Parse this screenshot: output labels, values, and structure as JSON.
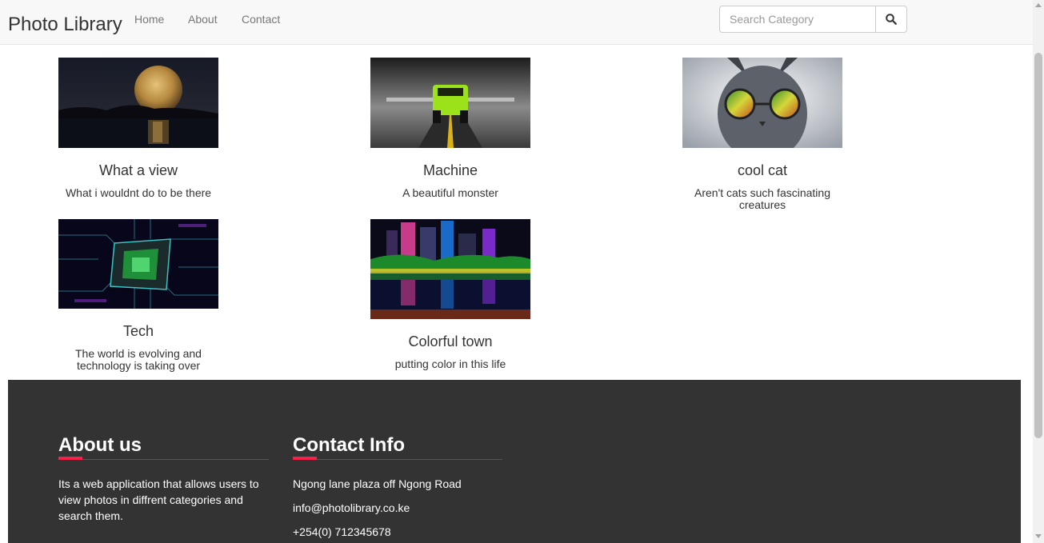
{
  "navbar": {
    "brand": "Photo Library",
    "links": [
      "Home",
      "About",
      "Contact"
    ],
    "search_placeholder": "Search Category"
  },
  "gallery": [
    {
      "title": "What a view",
      "description": "What i wouldnt do to be there"
    },
    {
      "title": "Machine",
      "description": "A beautiful monster"
    },
    {
      "title": "cool cat",
      "description": "Aren't cats such fascinating creatures"
    },
    {
      "title": "Tech",
      "description": "The world is evolving and technology is taking over"
    },
    {
      "title": "Colorful town",
      "description": "putting color in this life"
    }
  ],
  "footer": {
    "about": {
      "heading": "About us",
      "text": "Its a web application that allows users to view photos in diffrent categories and search them."
    },
    "contact": {
      "heading": "Contact Info",
      "address": "Ngong lane plaza off Ngong Road",
      "email": "info@photolibrary.co.ke",
      "phone": "+254(0) 712345678"
    }
  },
  "colors": {
    "navbar_bg": "#f8f8f8",
    "footer_bg": "#333333",
    "footer_accent": "#ff1d4a"
  }
}
